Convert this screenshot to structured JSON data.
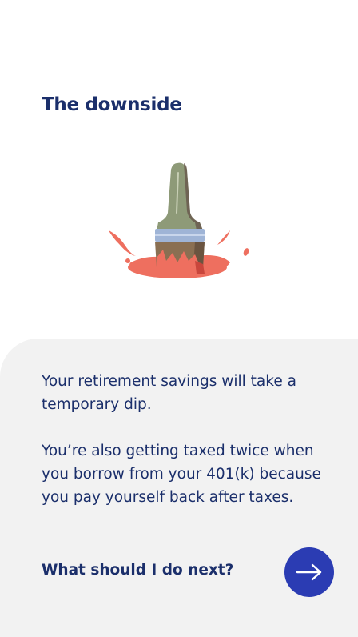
{
  "screen": {
    "title": "The downside",
    "illustration_icon": "paintbrush-splash-icon",
    "paragraphs": [
      "Your retirement savings will take a temporary dip.",
      "You’re also getting taxed twice when you borrow from your 401(k) because you pay yourself back after taxes."
    ],
    "next_prompt": "What should I do next?",
    "next_icon": "arrow-right-icon"
  },
  "colors": {
    "heading": "#1b2f6b",
    "panel_background": "#f2f2f2",
    "button": "#2b3cb3",
    "paint": "#ee6f5f"
  }
}
